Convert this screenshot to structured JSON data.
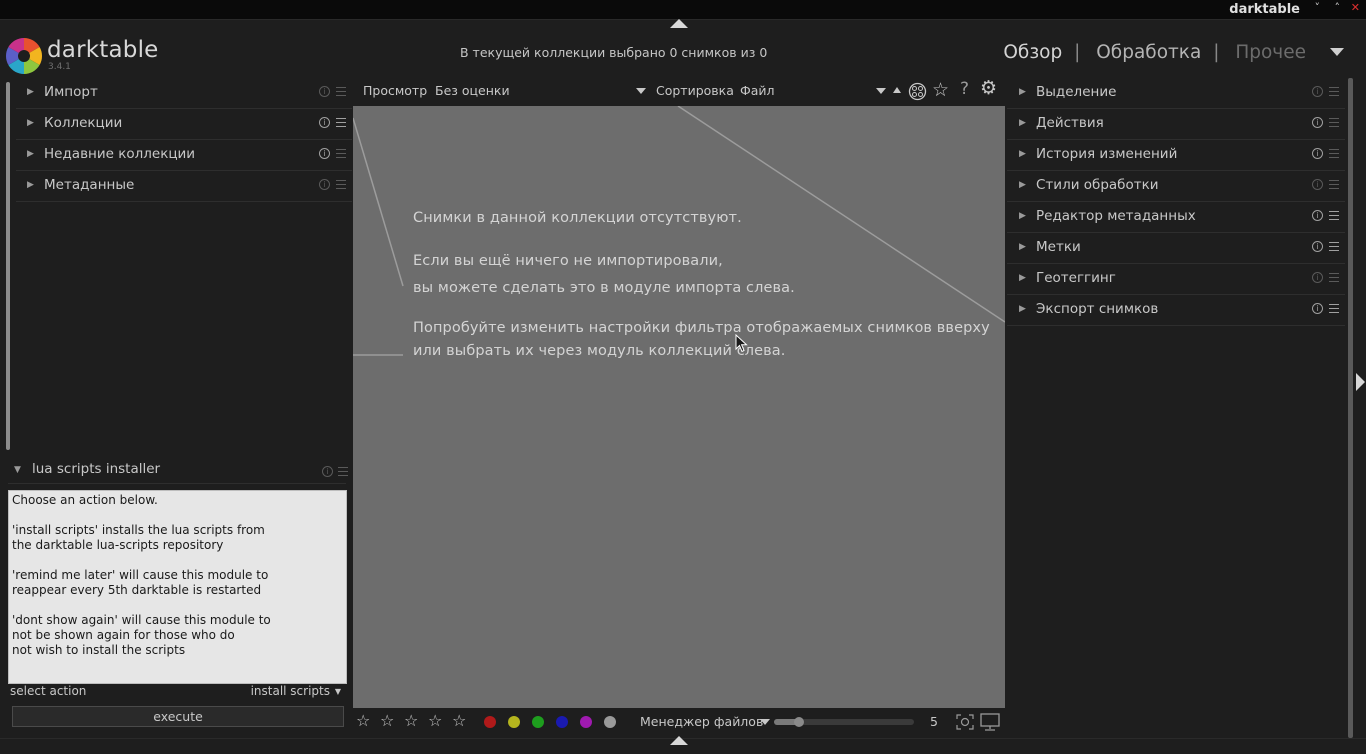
{
  "window": {
    "title": "darktable",
    "controls": [
      "˅",
      "˄",
      "✕"
    ]
  },
  "header": {
    "app_name": "darktable",
    "version": "3.4.1",
    "collection_info": "В текущей коллекции выбрано 0 снимков из 0",
    "views": [
      {
        "label": "Обзор",
        "state": "active"
      },
      {
        "label": "Обработка",
        "state": "normal"
      },
      {
        "label": "Прочее",
        "state": "dim"
      }
    ],
    "separator": "|"
  },
  "left_panel": {
    "modules": [
      {
        "label": "Импорт"
      },
      {
        "label": "Коллекции"
      },
      {
        "label": "Недавние коллекции"
      },
      {
        "label": "Метаданные"
      }
    ],
    "lua": {
      "title": "lua scripts installer",
      "text": "Choose an action below.\n\n'install scripts' installs the lua scripts from\nthe darktable lua-scripts repository\n\n'remind me later' will cause this module to\nreappear every 5th darktable is restarted\n\n'dont show again' will cause this module to\nnot be shown again for those who do\nnot wish to install the scripts",
      "select_label": "select action",
      "select_value": "install scripts",
      "execute_label": "execute"
    }
  },
  "filterbar": {
    "view_label": "Просмотр",
    "view_value": "Без оценки",
    "sort_label": "Сортировка",
    "sort_value": "Файл"
  },
  "lighttable": {
    "messages": [
      "Снимки в данной коллекции отсутствуют.",
      "Если вы ещё ничего не импортировали,",
      "вы можете сделать это в модуле импорта слева.",
      "Попробуйте изменить настройки фильтра отображаемых снимков вверху",
      "или выбрать их через модуль коллекций слева."
    ],
    "background": "#6d6d6d"
  },
  "bottombar": {
    "stars": [
      "☆",
      "☆",
      "☆",
      "☆",
      "☆"
    ],
    "color_labels": [
      "#b01a1a",
      "#b5b51e",
      "#1e9e1e",
      "#1a1ab0",
      "#a01ab0",
      "#9a9a9a"
    ],
    "layout_label": "Менеджер файлов",
    "zoom_value": "5",
    "zoom_fraction": 0.18
  },
  "right_panel": {
    "modules": [
      {
        "label": "Выделение"
      },
      {
        "label": "Действия"
      },
      {
        "label": "История изменений"
      },
      {
        "label": "Стили обработки"
      },
      {
        "label": "Редактор метаданных"
      },
      {
        "label": "Метки"
      },
      {
        "label": "Геотеггинг"
      },
      {
        "label": "Экспорт снимков"
      }
    ]
  },
  "icons": {
    "expand_triangle": "▶",
    "collapse_triangle": "▼",
    "info": "i",
    "star": "☆",
    "help": "?",
    "gear": "⚙"
  }
}
